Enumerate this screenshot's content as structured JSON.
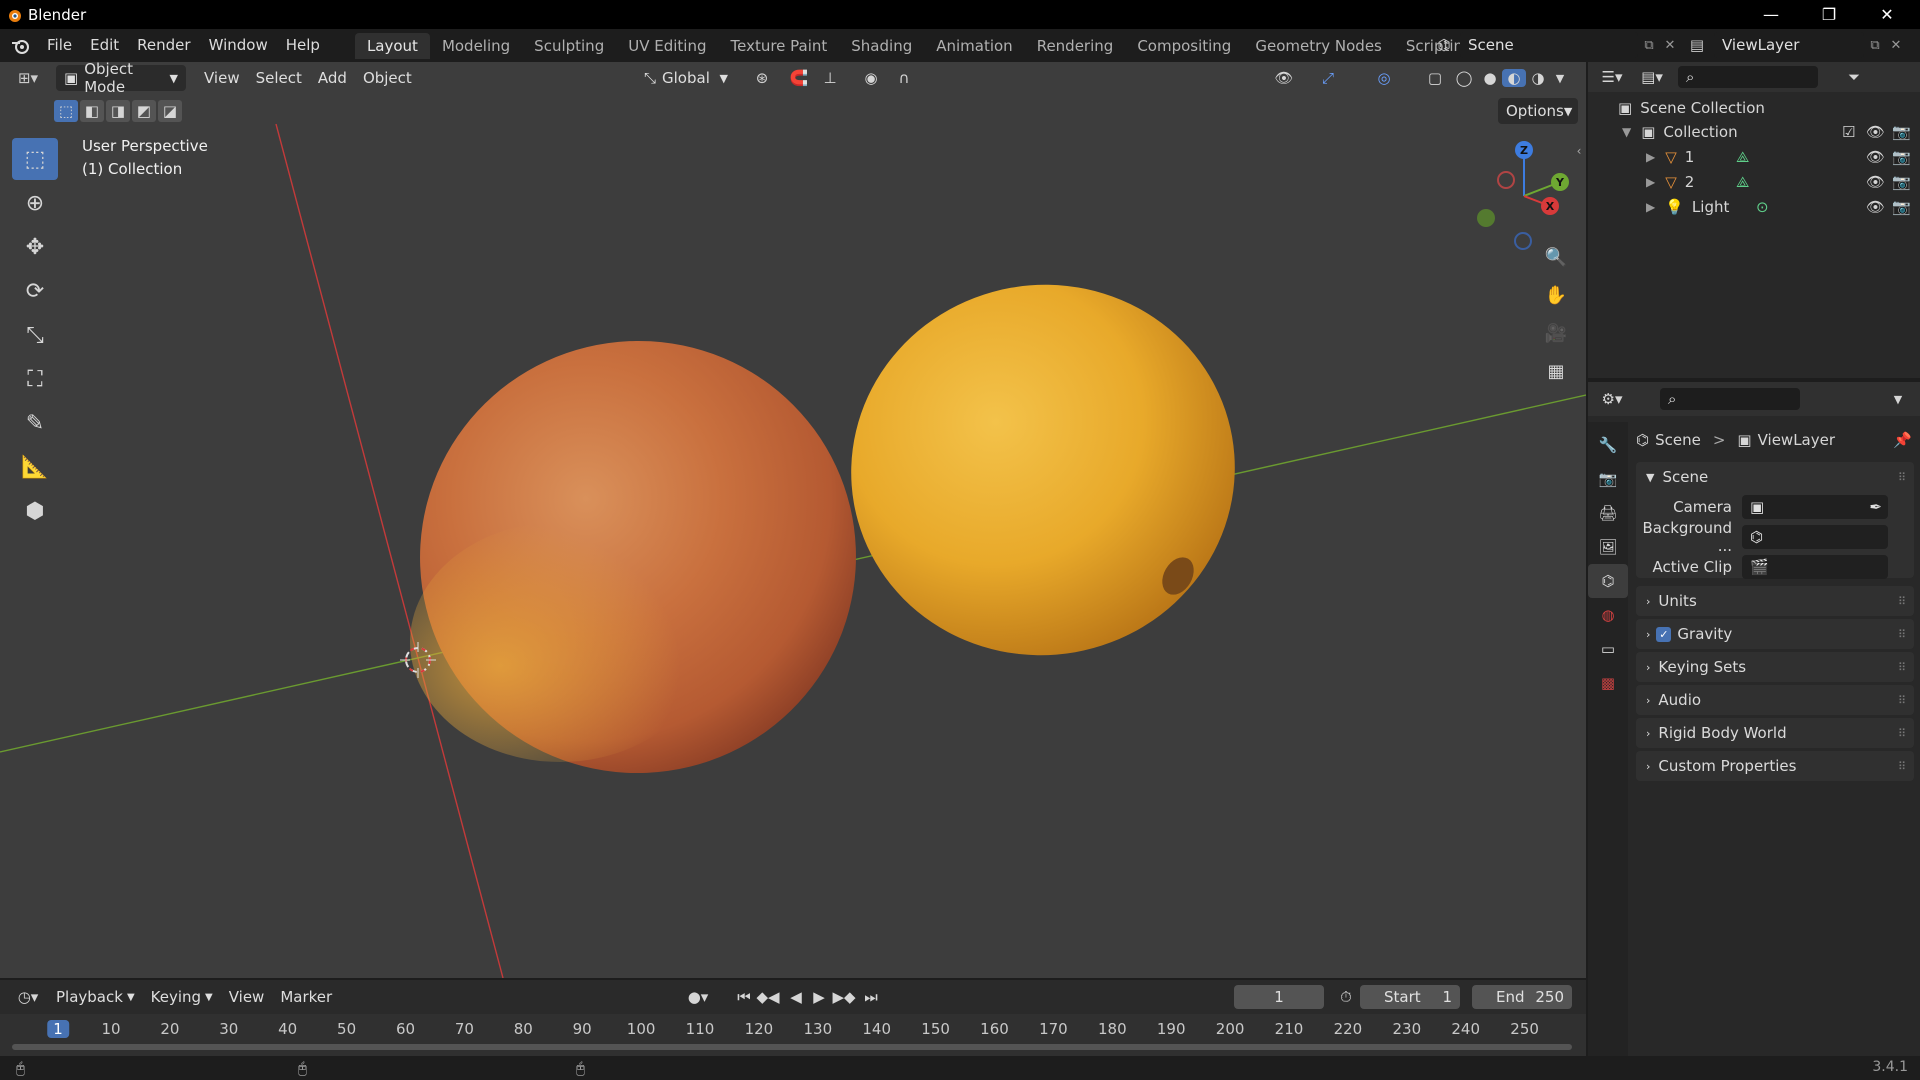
{
  "window": {
    "title": "Blender",
    "minimize": "—",
    "maximize": "❐",
    "close": "✕"
  },
  "menubar": {
    "items": [
      "File",
      "Edit",
      "Render",
      "Window",
      "Help"
    ],
    "workspaces": [
      "Layout",
      "Modeling",
      "Sculpting",
      "UV Editing",
      "Texture Paint",
      "Shading",
      "Animation",
      "Rendering",
      "Compositing",
      "Geometry Nodes",
      "Scripting"
    ],
    "add_tab": "+",
    "scene": "Scene",
    "view_layer": "ViewLayer"
  },
  "viewport": {
    "mode": "Object Mode",
    "menus": [
      "View",
      "Select",
      "Add",
      "Object"
    ],
    "transform_orientation": "Global",
    "options_label": "Options",
    "overlay_title": "User Perspective",
    "overlay_subtitle": "(1) Collection",
    "gizmo": {
      "z": "Z",
      "y": "Y",
      "x": "X"
    }
  },
  "outliner": {
    "root": "Scene Collection",
    "collection": "Collection",
    "items": [
      {
        "name": "1"
      },
      {
        "name": "2"
      },
      {
        "name": "Light"
      }
    ]
  },
  "properties": {
    "breadcrumb_scene": "Scene",
    "breadcrumb_sep": ">",
    "breadcrumb_layer": "ViewLayer",
    "scene_panel_title": "Scene",
    "fields": [
      {
        "label": "Camera"
      },
      {
        "label": "Background ..."
      },
      {
        "label": "Active Clip"
      }
    ],
    "panels": [
      "Units",
      "Gravity",
      "Keying Sets",
      "Audio",
      "Rigid Body World",
      "Custom Properties"
    ],
    "gravity_checked": true
  },
  "timeline": {
    "menus": [
      "Playback",
      "Keying",
      "View",
      "Marker"
    ],
    "current_frame": "1",
    "start_label": "Start",
    "start_value": "1",
    "end_label": "End",
    "end_value": "250",
    "ticks": [
      "1",
      "10",
      "20",
      "30",
      "40",
      "50",
      "60",
      "70",
      "80",
      "90",
      "100",
      "110",
      "120",
      "130",
      "140",
      "150",
      "160",
      "170",
      "180",
      "190",
      "200",
      "210",
      "220",
      "230",
      "240",
      "250"
    ]
  },
  "statusbar": {
    "version": "3.4.1"
  },
  "colors": {
    "accent": "#4772b3",
    "x_axis": "#d83a3a",
    "y_axis": "#6ea832",
    "z_axis": "#3d7ce0"
  }
}
